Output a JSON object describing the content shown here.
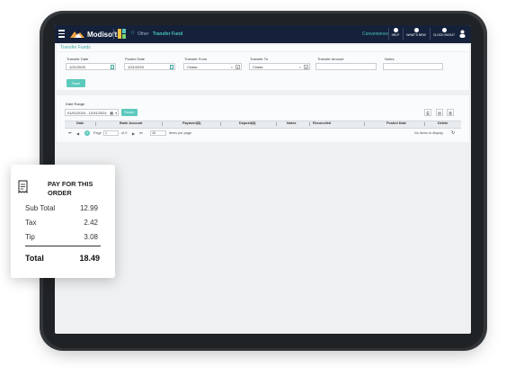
{
  "app": {
    "brand": "Modisoft",
    "breadcrumb_section": "Other",
    "breadcrumb_page": "Transfer Fund",
    "company": "Convenience",
    "buttons": {
      "help": "HELP",
      "whats_new": "WHAT'S NEW",
      "clock_in_out": "CLOCK IN/OUT"
    }
  },
  "form": {
    "title": "Transfer Funds",
    "transfer_date": {
      "label": "Transfer Date",
      "value": "1/21/2025"
    },
    "posted_date": {
      "label": "Posted Date",
      "value": "1/21/2025"
    },
    "transfer_from": {
      "label": "Transfer From",
      "value": "Chase"
    },
    "transfer_to": {
      "label": "Transfer To",
      "value": "Chase"
    },
    "transfer_amount": {
      "label": "Transfer Amount",
      "value": ""
    },
    "notes": {
      "label": "Notes",
      "value": ""
    },
    "save_label": "Save"
  },
  "grid": {
    "date_range_label": "Date Range",
    "date_range_value": "01/01/2024 - 12/31/2024",
    "search_label": "Search",
    "columns": [
      "Date",
      "Bank Account",
      "Payment($)",
      "Deposit($)",
      "Notes",
      "Reconciled",
      "Posted Date",
      "Delete"
    ],
    "pager": {
      "page_label": "Page",
      "page_value": "1",
      "of_label": "of 0",
      "current_page": "0",
      "page_size": "10",
      "items_per_page": "items per page",
      "empty_message": "No items to display"
    }
  },
  "receipt": {
    "title": "PAY FOR THIS ORDER",
    "rows": [
      {
        "label": "Sub Total",
        "value": "12.99"
      },
      {
        "label": "Tax",
        "value": "2.42"
      },
      {
        "label": "Tip",
        "value": "3.08"
      }
    ],
    "total_label": "Total",
    "total_value": "18.49"
  },
  "colors": {
    "accent": "#5bc9bc",
    "topbar": "#15213b",
    "device": "#202326"
  }
}
